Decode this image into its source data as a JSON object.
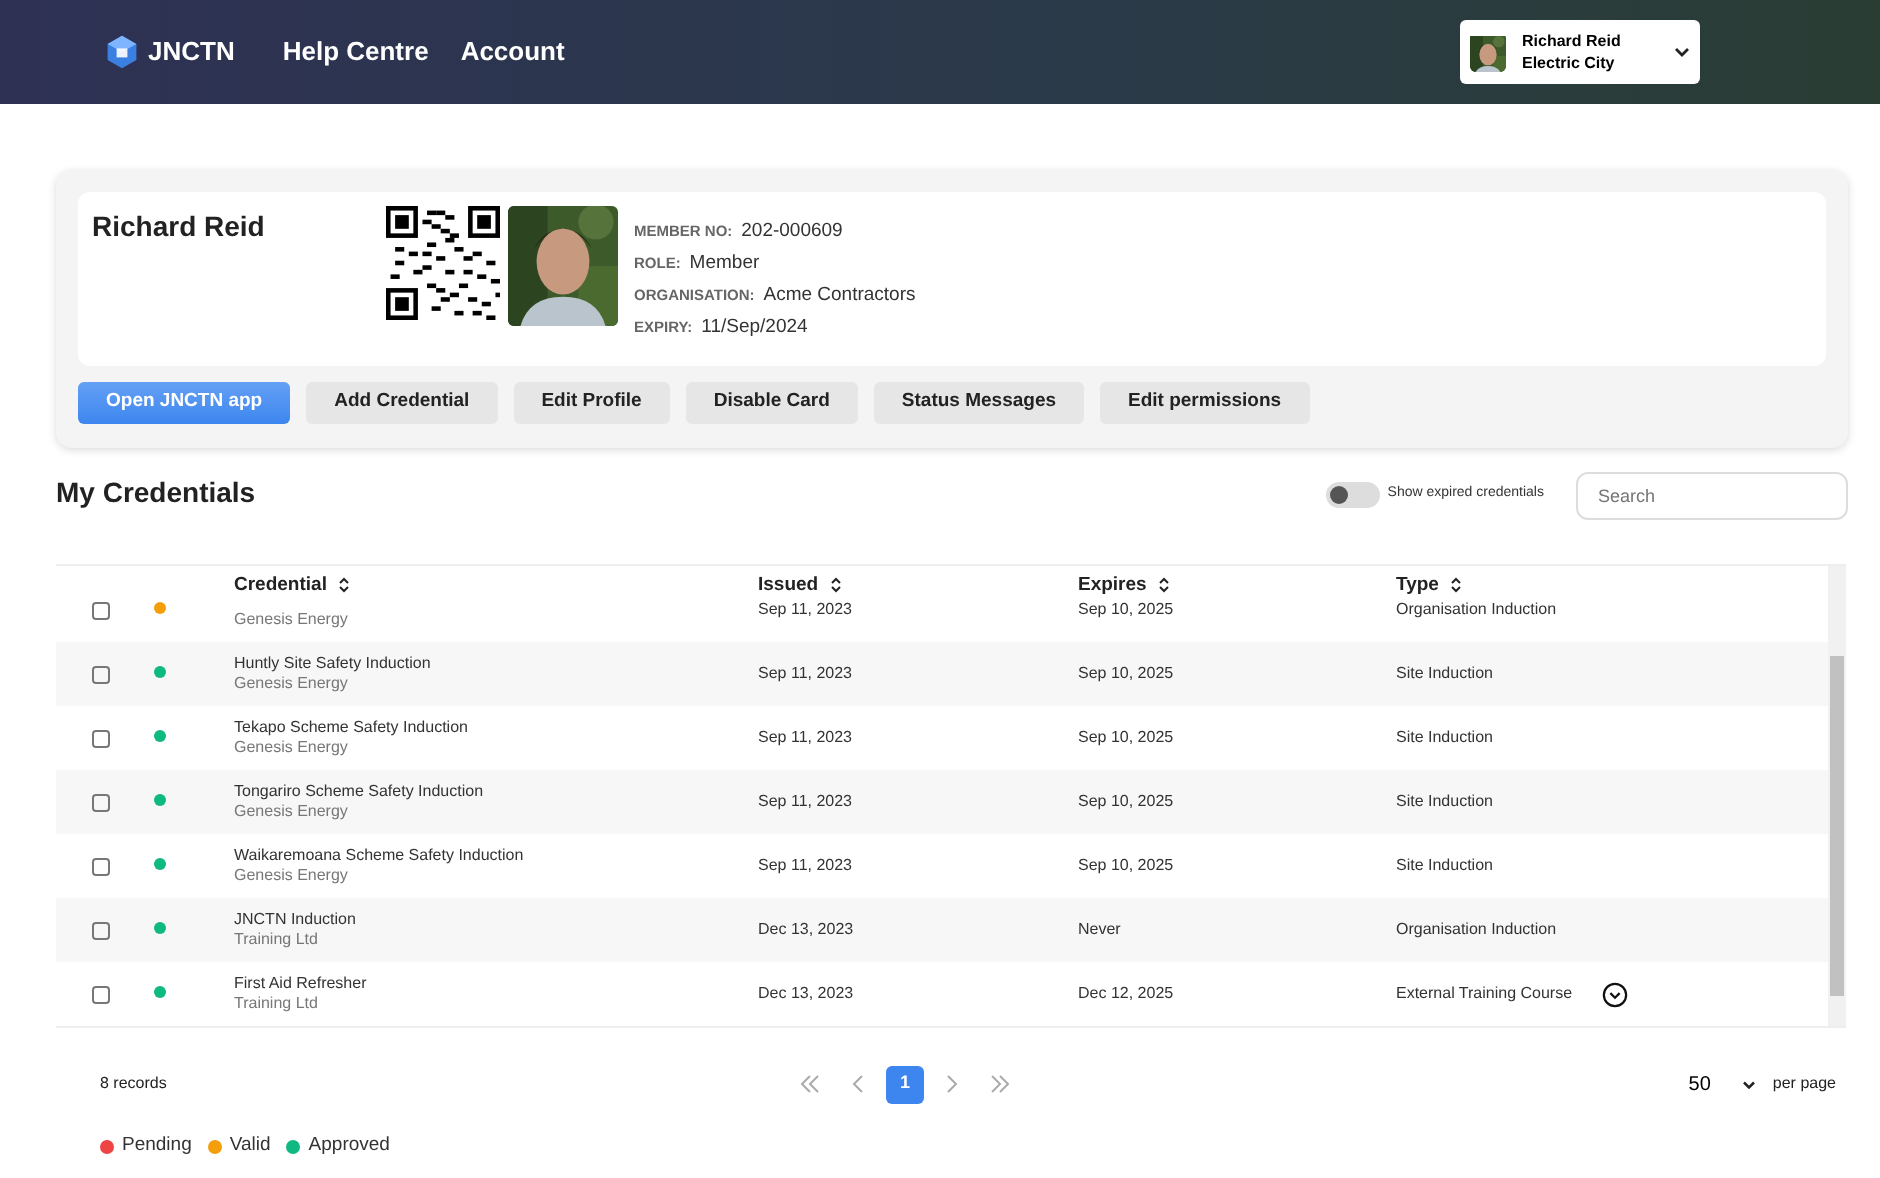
{
  "header": {
    "logo": "JNCTN",
    "nav": [
      "Help Centre",
      "Account"
    ],
    "user": {
      "name": "Richard Reid",
      "org": "Electric City"
    }
  },
  "profile": {
    "name": "Richard Reid",
    "fields": [
      {
        "label": "MEMBER NO:",
        "value": "202-000609"
      },
      {
        "label": "ROLE:",
        "value": "Member"
      },
      {
        "label": "ORGANISATION:",
        "value": "Acme Contractors"
      },
      {
        "label": "EXPIRY:",
        "value": "11/Sep/2024"
      }
    ],
    "buttons": [
      {
        "label": "Open JNCTN app",
        "kind": "primary"
      },
      {
        "label": "Add Credential",
        "kind": "secondary"
      },
      {
        "label": "Edit Profile",
        "kind": "secondary"
      },
      {
        "label": "Disable Card",
        "kind": "secondary"
      },
      {
        "label": "Status Messages",
        "kind": "secondary"
      },
      {
        "label": "Edit permissions",
        "kind": "secondary"
      }
    ]
  },
  "credentials": {
    "title": "My Credentials",
    "toggle": {
      "label": "Show expired credentials",
      "on": false
    },
    "search": {
      "placeholder": "Search"
    },
    "columns": [
      "Credential",
      "Issued",
      "Expires",
      "Type"
    ],
    "rows": [
      {
        "checked": false,
        "color": "#f59e0b",
        "org": "Genesis Energy",
        "issued": "Sep 11, 2023",
        "expires": "Sep 10, 2025",
        "type": "Organisation Induction"
      },
      {
        "checked": false,
        "color": "#10b981",
        "name": "Huntly Site Safety Induction",
        "org": "Genesis Energy",
        "issued": "Sep 11, 2023",
        "expires": "Sep 10, 2025",
        "type": "Site Induction"
      },
      {
        "checked": false,
        "color": "#10b981",
        "name": "Tekapo Scheme Safety Induction",
        "org": "Genesis Energy",
        "issued": "Sep 11, 2023",
        "expires": "Sep 10, 2025",
        "type": "Site Induction"
      },
      {
        "checked": false,
        "color": "#10b981",
        "name": "Tongariro Scheme Safety Induction",
        "org": "Genesis Energy",
        "issued": "Sep 11, 2023",
        "expires": "Sep 10, 2025",
        "type": "Site Induction"
      },
      {
        "checked": false,
        "color": "#10b981",
        "name": "Waikaremoana Scheme Safety Induction",
        "org": "Genesis Energy",
        "issued": "Sep 11, 2023",
        "expires": "Sep 10, 2025",
        "type": "Site Induction"
      },
      {
        "checked": false,
        "color": "#10b981",
        "name": "JNCTN Induction",
        "org": "Training Ltd",
        "issued": "Dec 13, 2023",
        "expires": "Never",
        "type": "Organisation Induction"
      },
      {
        "checked": false,
        "color": "#10b981",
        "name": "First Aid Refresher",
        "org": "Training Ltd",
        "issued": "Dec 13, 2023",
        "expires": "Dec 12, 2025",
        "type": "External Training Course",
        "expand": true
      }
    ],
    "records": "8 records",
    "pages": [
      {
        "label": "1",
        "selected": true
      }
    ],
    "per_page": {
      "value": "50",
      "label": "per page"
    },
    "legend": [
      {
        "label": "Pending",
        "color": "#ef4444"
      },
      {
        "label": "Valid",
        "color": "#f59e0b"
      },
      {
        "label": "Approved",
        "color": "#10b981"
      }
    ]
  }
}
